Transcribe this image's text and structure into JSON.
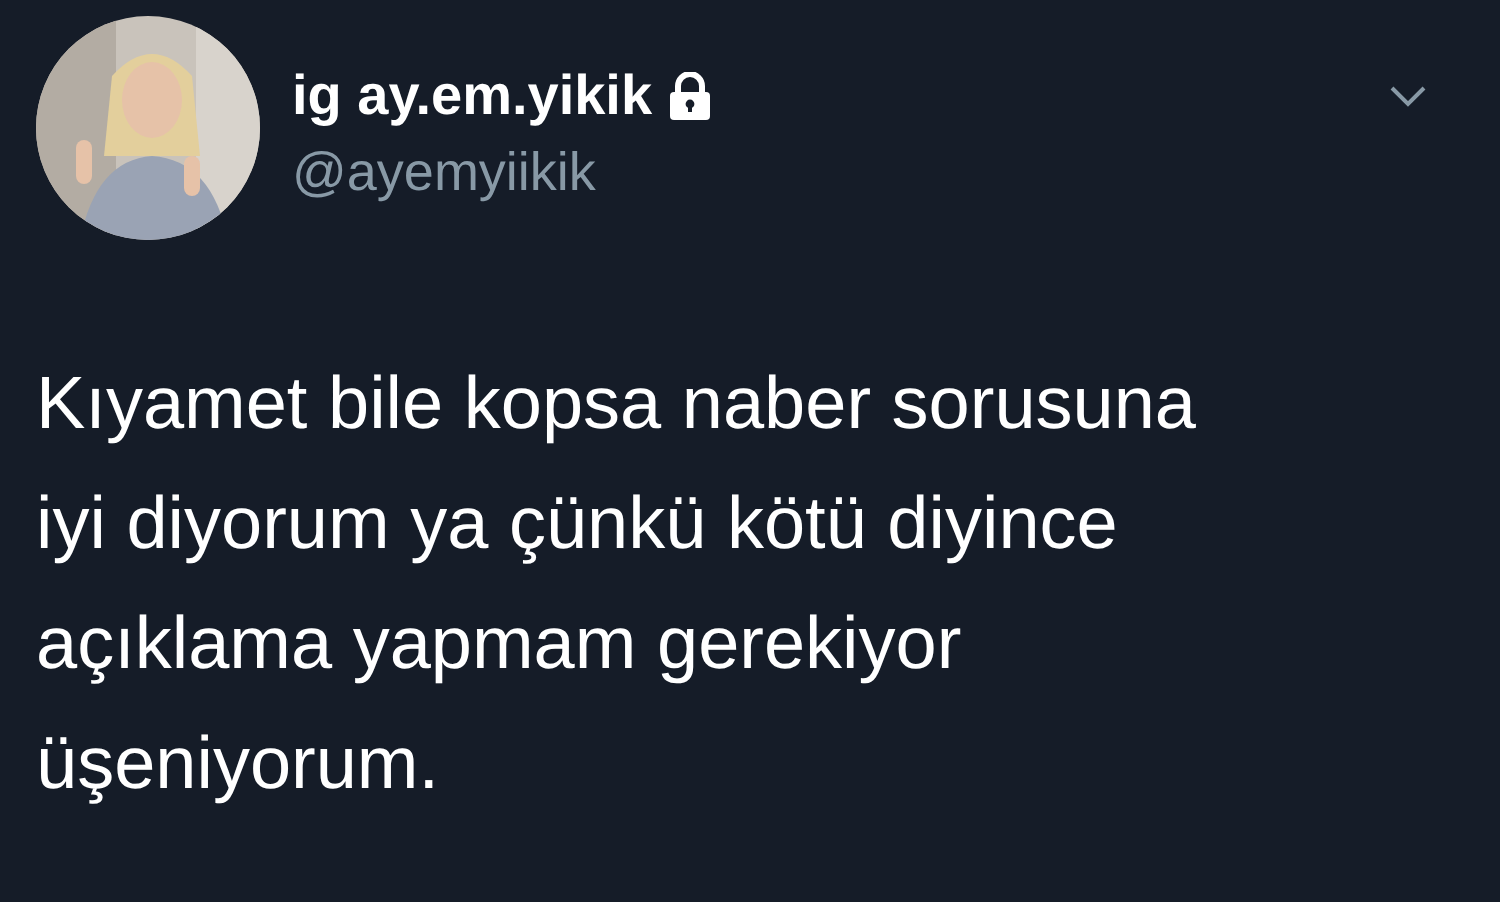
{
  "tweet": {
    "display_name": "ig ay.em.yikik",
    "protected": true,
    "handle": "@ayemyiikik",
    "text_lines": [
      "Kıyamet bile kopsa naber sorusuna",
      "iyi diyorum ya çünkü kötü diyince",
      "açıklama yapmam gerekiyor",
      "üşeniyorum."
    ]
  }
}
